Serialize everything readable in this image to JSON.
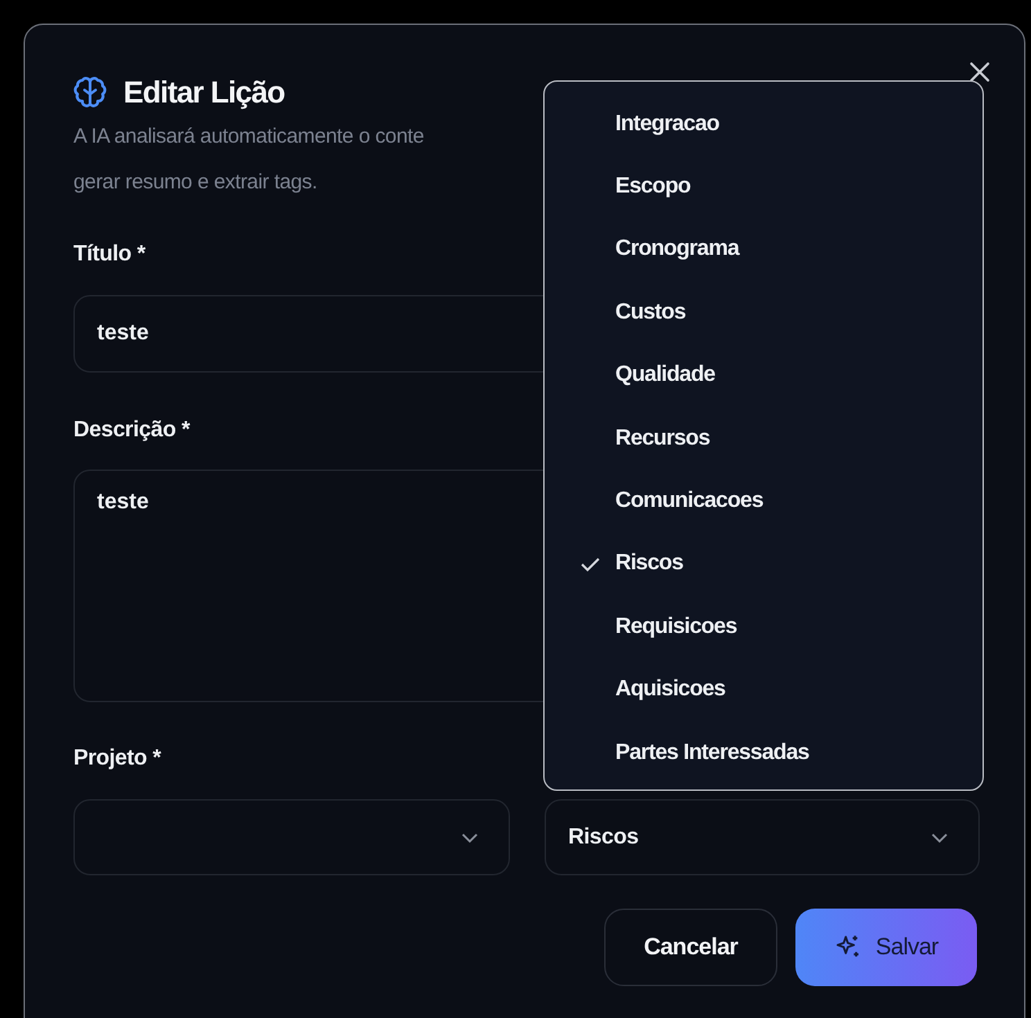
{
  "dialog": {
    "title": "Editar Lição",
    "subtitle_lines": [
      "A IA analisará automaticamente o conte",
      "gerar resumo e extrair tags."
    ],
    "title_field": {
      "label": "Título *",
      "value": "teste"
    },
    "description_field": {
      "label": "Descrição *",
      "value": "teste"
    },
    "project_field": {
      "label": "Projeto *"
    },
    "category_select": {
      "value": "Riscos"
    },
    "buttons": [
      {
        "label": "Cancelar",
        "kind": "secondary"
      },
      {
        "label": "Salvar",
        "kind": "primary"
      }
    ]
  },
  "dropdown": {
    "items": [
      {
        "label": "Integracao",
        "selected": false
      },
      {
        "label": "Escopo",
        "selected": false
      },
      {
        "label": "Cronograma",
        "selected": false
      },
      {
        "label": "Custos",
        "selected": false
      },
      {
        "label": "Qualidade",
        "selected": false
      },
      {
        "label": "Recursos",
        "selected": false
      },
      {
        "label": "Comunicacoes",
        "selected": false
      },
      {
        "label": "Riscos",
        "selected": true
      },
      {
        "label": "Requisicoes",
        "selected": false
      },
      {
        "label": "Aquisicoes",
        "selected": false
      },
      {
        "label": "Partes Interessadas",
        "selected": false
      }
    ]
  }
}
